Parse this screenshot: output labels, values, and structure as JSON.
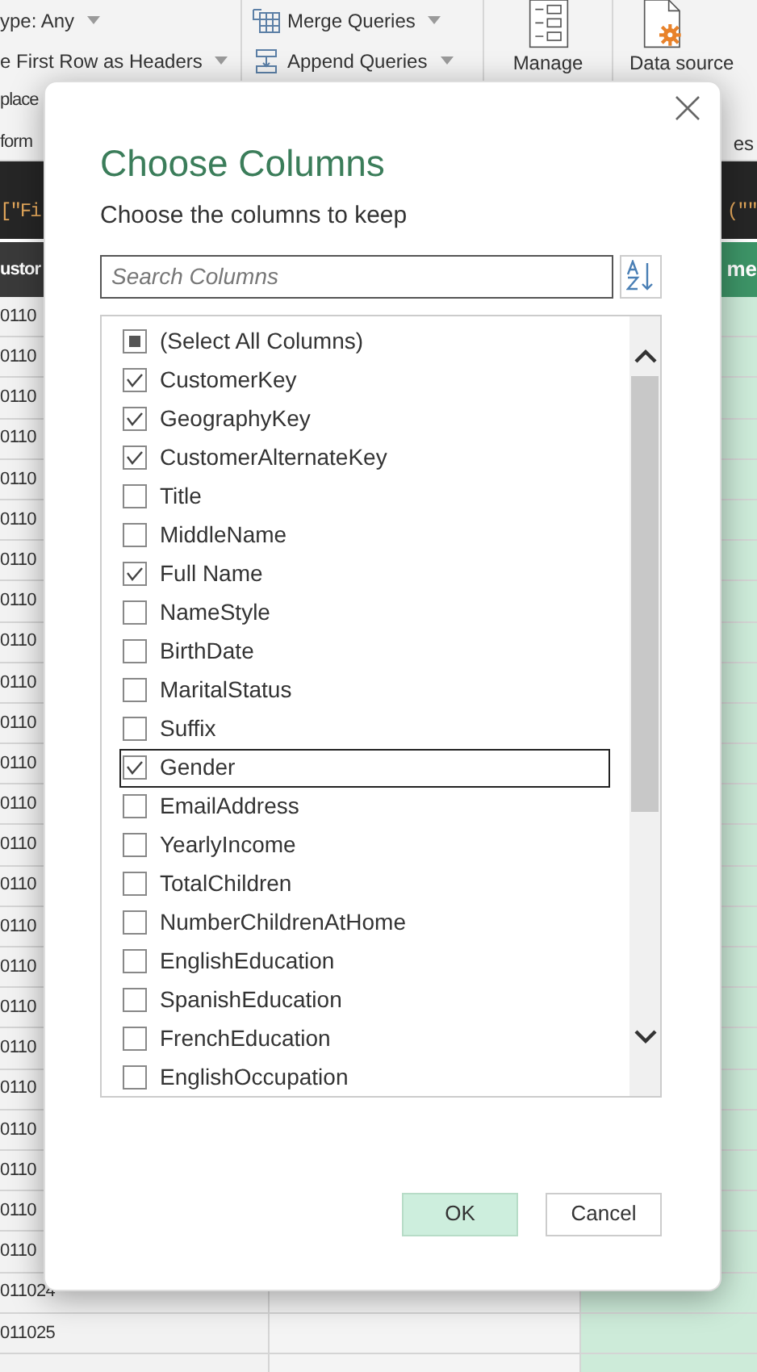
{
  "ribbon": {
    "groups": [
      {
        "items": [
          {
            "label": "ype: Any",
            "dropdown": true
          },
          {
            "label": "e First Row as Headers",
            "dropdown": true
          },
          {
            "label": "place",
            "dropdown": false
          }
        ],
        "group_label": "form"
      },
      {
        "items": [
          {
            "label": "Merge Queries",
            "dropdown": true
          },
          {
            "label": "Append Queries",
            "dropdown": true
          }
        ]
      }
    ],
    "manage": {
      "label": "Manage"
    },
    "data_source": {
      "label": "Data source"
    },
    "group_label_right": "es"
  },
  "formula_bar": {
    "left": "[\"Fi",
    "right": "(\"\""
  },
  "grid": {
    "columns": [
      {
        "label": "ustor"
      },
      {
        "label": "me"
      }
    ],
    "rows": [
      "0110",
      "0110",
      "0110",
      "0110",
      "0110",
      "0110",
      "0110",
      "0110",
      "0110",
      "0110",
      "0110",
      "0110",
      "0110",
      "0110",
      "0110",
      "0110",
      "0110",
      "0110",
      "0110",
      "0110",
      "0110",
      "0110",
      "0110",
      "0110",
      "011024",
      "011025"
    ]
  },
  "dialog": {
    "title": "Choose Columns",
    "subtitle": "Choose the columns to keep",
    "search": {
      "placeholder": "Search Columns"
    },
    "columns": [
      {
        "label": "(Select All Columns)",
        "kind": "select_all",
        "indeterminate": true,
        "focused": false
      },
      {
        "label": "CustomerKey",
        "kind": "column",
        "checked": true,
        "focused": false
      },
      {
        "label": "GeographyKey",
        "kind": "column",
        "checked": true,
        "focused": false
      },
      {
        "label": "CustomerAlternateKey",
        "kind": "column",
        "checked": true,
        "focused": false
      },
      {
        "label": "Title",
        "kind": "column",
        "checked": false,
        "focused": false
      },
      {
        "label": "MiddleName",
        "kind": "column",
        "checked": false,
        "focused": false
      },
      {
        "label": "Full Name",
        "kind": "column",
        "checked": true,
        "focused": false
      },
      {
        "label": "NameStyle",
        "kind": "column",
        "checked": false,
        "focused": false
      },
      {
        "label": "BirthDate",
        "kind": "column",
        "checked": false,
        "focused": false
      },
      {
        "label": "MaritalStatus",
        "kind": "column",
        "checked": false,
        "focused": false
      },
      {
        "label": "Suffix",
        "kind": "column",
        "checked": false,
        "focused": false
      },
      {
        "label": "Gender",
        "kind": "column",
        "checked": true,
        "focused": true
      },
      {
        "label": "EmailAddress",
        "kind": "column",
        "checked": false,
        "focused": false
      },
      {
        "label": "YearlyIncome",
        "kind": "column",
        "checked": false,
        "focused": false
      },
      {
        "label": "TotalChildren",
        "kind": "column",
        "checked": false,
        "focused": false
      },
      {
        "label": "NumberChildrenAtHome",
        "kind": "column",
        "checked": false,
        "focused": false
      },
      {
        "label": "EnglishEducation",
        "kind": "column",
        "checked": false,
        "focused": false
      },
      {
        "label": "SpanishEducation",
        "kind": "column",
        "checked": false,
        "focused": false
      },
      {
        "label": "FrenchEducation",
        "kind": "column",
        "checked": false,
        "focused": false
      },
      {
        "label": "EnglishOccupation",
        "kind": "column",
        "checked": false,
        "focused": false
      }
    ],
    "buttons": [
      {
        "label": "OK",
        "primary": true
      },
      {
        "label": "Cancel",
        "primary": false
      }
    ]
  }
}
